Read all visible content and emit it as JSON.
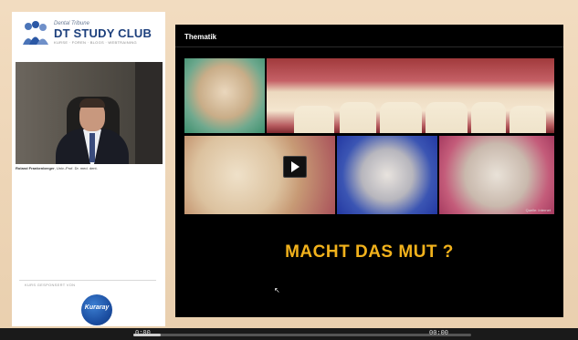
{
  "brand": {
    "top_line": "Dental Tribune",
    "name": "DT STUDY CLUB",
    "tagline": "KURSE · FOREN · BLOGS · WEBTRAINING"
  },
  "presenter": {
    "name": "Roland Frankenberger",
    "title": ", Univ.-Prof. Dr. med. dent."
  },
  "sponsor": {
    "label": "KURS GESPONSERT VON",
    "logo_text": "Kuraray"
  },
  "slide": {
    "section_title": "Thematik",
    "headline": "MACHT DAS MUT ?",
    "source_note": "Quelle: Internet"
  },
  "player": {
    "progress_fraction": 0.08,
    "time_left": "0:00",
    "time_right": "00:00"
  },
  "colors": {
    "headline": "#f2b21c",
    "brand": "#1c3f7c"
  }
}
